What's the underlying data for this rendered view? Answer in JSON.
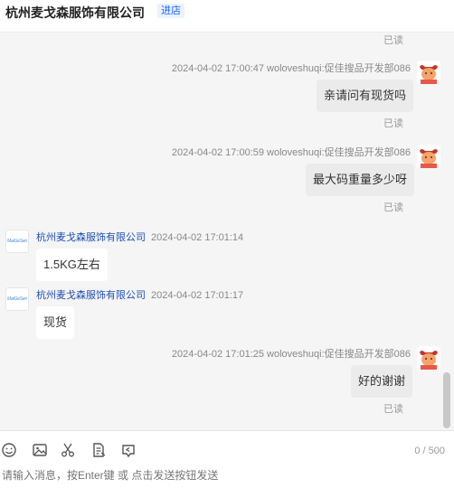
{
  "header": {
    "shop_name": "杭州麦戈森服饰有限公司",
    "shop_tag": "进店"
  },
  "messages": [
    {
      "read": "已读"
    },
    {
      "meta": "2024-04-02 17:00:47  woloveshuqi:促佳搜品开发部086",
      "text": "亲请问有现货吗",
      "read": "已读"
    },
    {
      "meta": "2024-04-02 17:00:59  woloveshuqi:促佳搜品开发部086",
      "text": "最大码重量多少呀",
      "read": "已读"
    },
    {
      "sender": "杭州麦戈森服饰有限公司",
      "time": "2024-04-02 17:01:14",
      "text": "1.5KG左右"
    },
    {
      "sender": "杭州麦戈森服饰有限公司",
      "time": "2024-04-02 17:01:17",
      "text": "现货"
    },
    {
      "meta": "2024-04-02 17:01:25  woloveshuqi:促佳搜品开发部086",
      "text": "好的谢谢",
      "read": "已读"
    }
  ],
  "icons": {
    "toolbar": [
      "emoji-icon",
      "image-icon",
      "scissors-icon",
      "order-icon",
      "history-icon"
    ],
    "avatars": [
      "user-avatar",
      "shop-logo"
    ]
  },
  "composer": {
    "counter": "0 / 500",
    "placeholder": "请输入消息，按Enter键 或 点击发送按钮发送"
  },
  "colors": {
    "chat_bg": "#f5f5f5",
    "own_bubble": "#ebebeb",
    "link_blue": "#1f4fb3",
    "tag_blue": "#1a66ff"
  }
}
